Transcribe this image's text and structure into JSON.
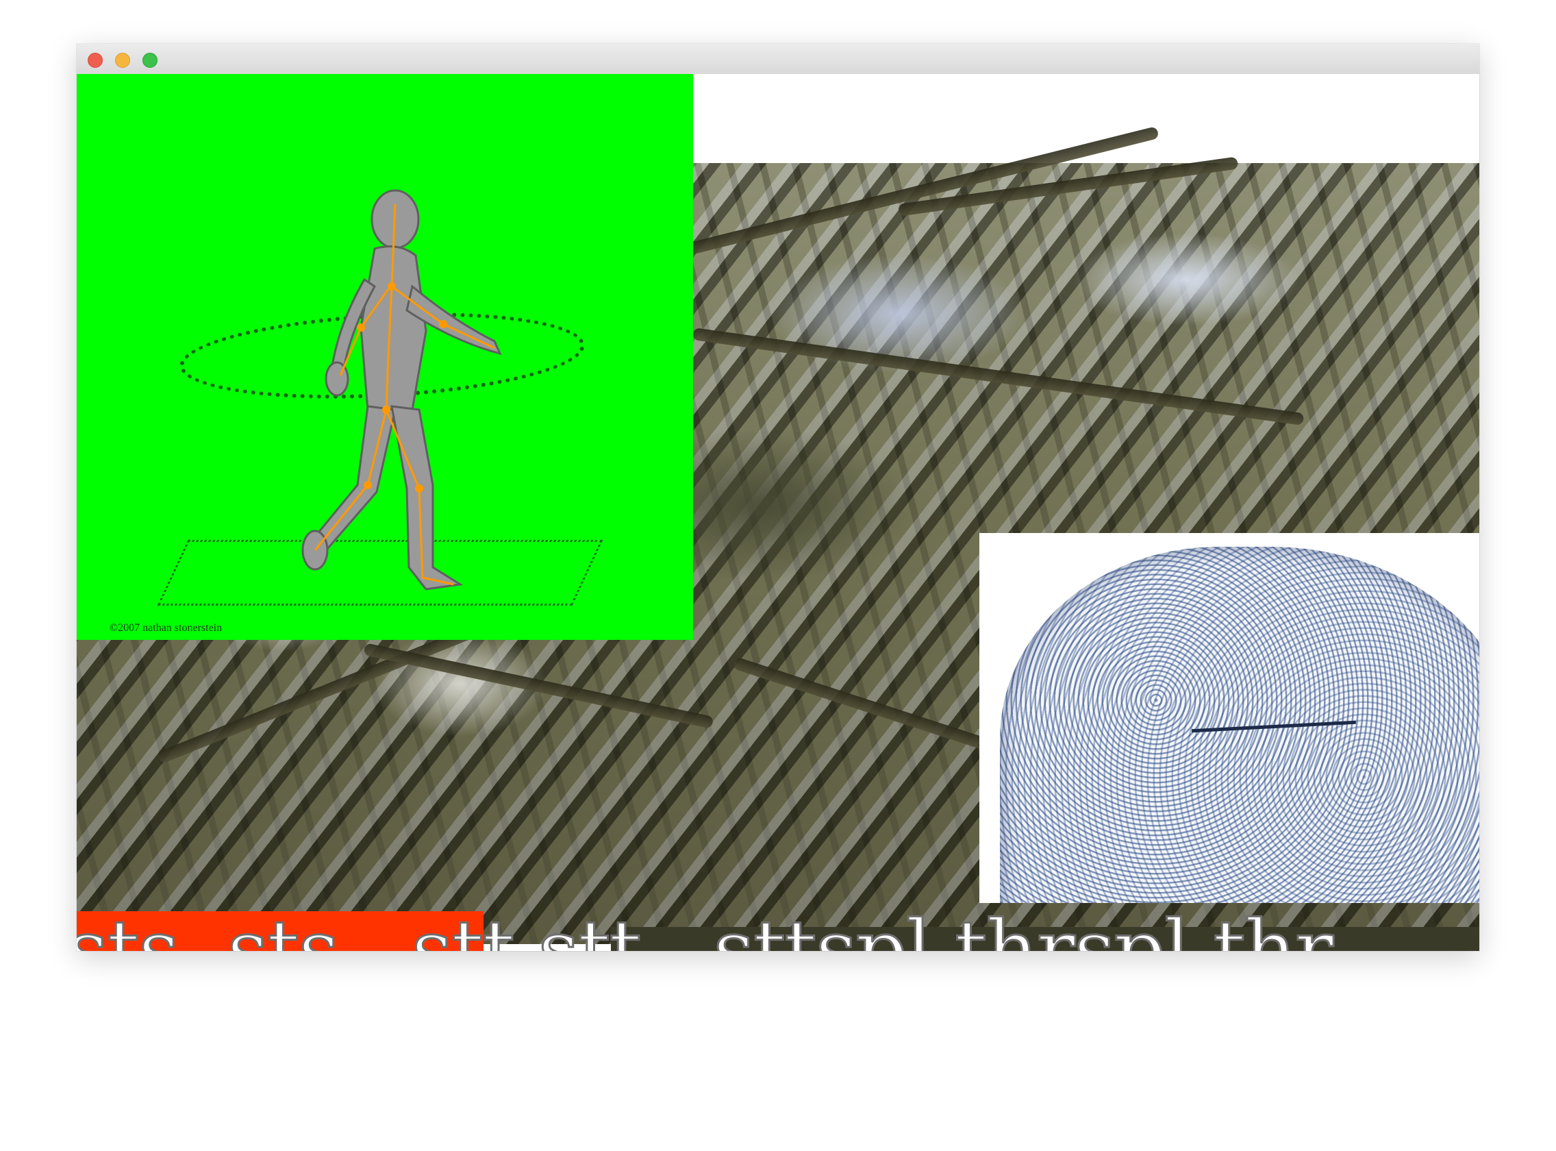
{
  "window": {
    "controls": [
      "close",
      "minimize",
      "maximize"
    ]
  },
  "green_panel": {
    "credit": "©2007 nathan stonerstein"
  },
  "text_band": {
    "line": "sts  sts   stt stt   sttspl thrspl thr"
  },
  "colors": {
    "green_screen": "#00ff00",
    "red_bar": "#ff3300",
    "close": "#ee5f50",
    "minimize": "#f5b53f",
    "maximize": "#3cc14a"
  }
}
